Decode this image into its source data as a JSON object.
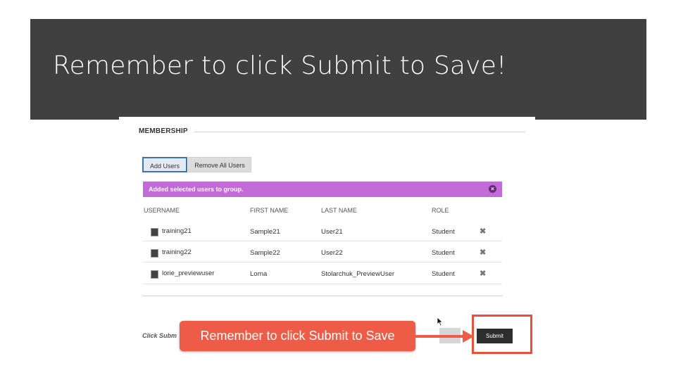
{
  "slide": {
    "title": "Remember to click Submit to Save!"
  },
  "section": {
    "heading": "MEMBERSHIP"
  },
  "buttons": {
    "add_users": "Add Users",
    "remove_all": "Remove All Users",
    "submit": "Submit"
  },
  "banner": {
    "message": "Added selected users to group.",
    "close_icon": "×"
  },
  "table": {
    "headers": {
      "username": "USERNAME",
      "first_name": "FIRST NAME",
      "last_name": "LAST NAME",
      "role": "ROLE"
    },
    "rows": [
      {
        "username": "training21",
        "first_name": "Sample21",
        "last_name": "User21",
        "role": "Student"
      },
      {
        "username": "training22",
        "first_name": "Sample22",
        "last_name": "User22",
        "role": "Student"
      },
      {
        "username": "lorie_previewuser",
        "first_name": "Lorna",
        "last_name": "Stolarchuk_PreviewUser",
        "role": "Student"
      }
    ],
    "remove_icon": "✖"
  },
  "footer": {
    "click_submit_text": "Click Subm"
  },
  "callout": {
    "text": "Remember to click Submit to Save"
  },
  "colors": {
    "title_bar": "#404040",
    "banner": "#c36ad9",
    "callout": "#ee5b46",
    "highlight": "#e8503a"
  },
  "icons": [
    "avatar-icon",
    "close-icon",
    "remove-x-icon",
    "mouse-pointer-icon",
    "arrow-right-icon"
  ]
}
